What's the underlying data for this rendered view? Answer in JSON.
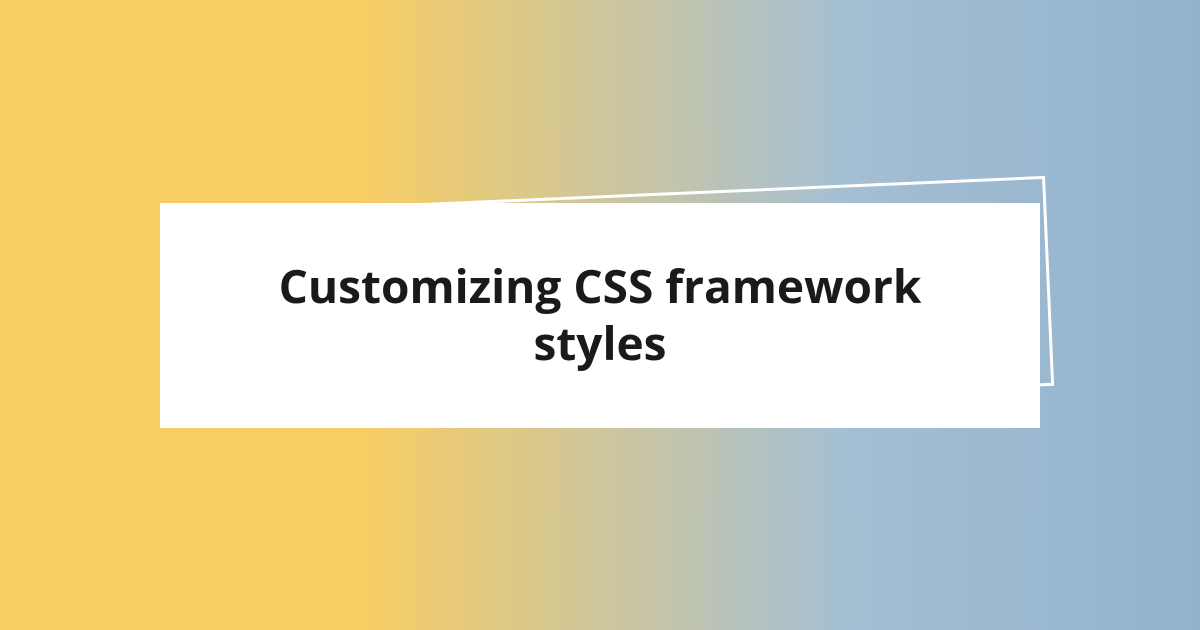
{
  "card": {
    "title": "Customizing CSS framework styles"
  },
  "colors": {
    "gradient_start": "#f8cd63",
    "gradient_end": "#91b2cd",
    "card_bg": "#ffffff",
    "outline": "#ffffff",
    "text": "#1a1a1a"
  }
}
